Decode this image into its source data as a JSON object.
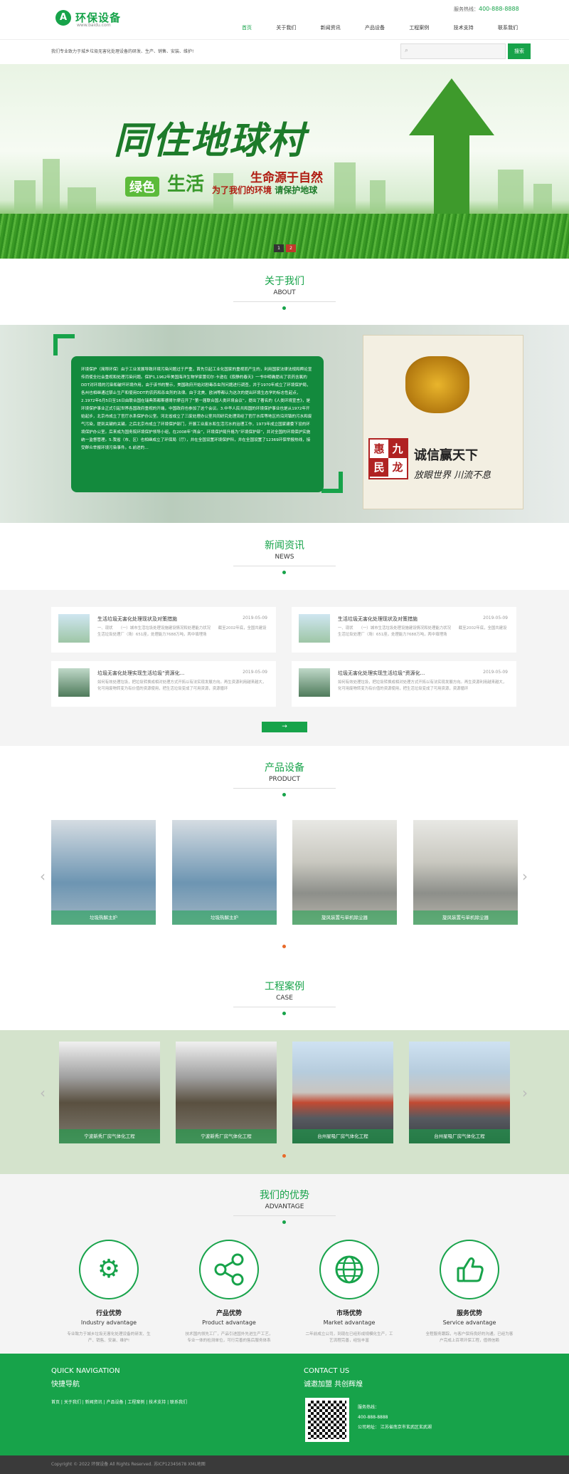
{
  "header": {
    "logo_mark": "A",
    "logo_text": "环保设备",
    "logo_sub": "www.baidu.com",
    "hotline_label": "服务热线：",
    "hotline_number": "400-888-8888",
    "nav": [
      "首页",
      "关于我们",
      "新闻资讯",
      "产品设备",
      "工程案例",
      "技术支持",
      "联系我们"
    ],
    "slogan": "我们专业致力于城乡垃圾无害化处理设备的研发、生产、销售、安装、维护!",
    "search_placeholder": "",
    "search_button": "搜索"
  },
  "banner": {
    "title": "同住地球村",
    "green_tag": "绿色",
    "life": "生活",
    "sub1": "生命源于自然",
    "sub2a": "为了我们的环境",
    "sub2b": "请保护地球",
    "dots": [
      "1",
      "2"
    ]
  },
  "about": {
    "title_cn": "关于我们",
    "title_en": "ABOUT",
    "text": "环境保护（简称环保）由于工业发展导致环境污染问题过于严重，首先引起工业化国家的重视而产生的，利用国家法律法规和舆论宣传而使全社会重视和处理污染问题。保护1,1962年美国海洋生物学家蕾切尔·卡逊在《寂静的春天》一书中明确提出了农药含氯的DDT对环境的污染和破坏环境作用，由于该书的警示，美国政府开始对剧毒杀虫剂问题进行调查，并于1970年成立了环境保护局，各州也相继通过禁止生产和使用DDT的农药和杀虫剂的法律。由于北美、欧洲等都认为这次的提出环境生态学的标志性起点，2.1972年6月5日至16日由联合国在瑞典首都斯德哥尔摩召开了“第一届联合国人类环境会议”，提出了著名的《人类环境宣言》，是环境保护事业正式引起世界各国政府重视的开端，中国政府也参加了这个会议。3.中华人民共和国的环境保护事业也是从1972年开始起步，北京市成立了官厅水系保护办公室。河北省成立了三废处理办公室共同研究处理流经了官厅水库等地区的沿河镇的污水和废气污染，提到关键的关键。之后北京市成立了环境保护部门，开展工业废水和生活污水的治理工作，1973年成立国家建委下设的环境保护办公室。后来成为国务院环境保护领导小组，在2008年“两会”，环境保护局升格为“环境保护部”，并对全国的环境保护实施统一监督管理。5.我省（市、区）也相继成立了环保局（厅），并在全国设置环境保护科，并在全国设置了12369环保举报热线，接受群众举报环境污染事件。6.前进的…",
    "motto": "诚信赢天下",
    "motto2": "放眼世界 川流不息",
    "seal": [
      "惠",
      "九",
      "民",
      "龙"
    ]
  },
  "news": {
    "title_cn": "新闻资讯",
    "title_en": "NEWS",
    "items": [
      {
        "title": "生活垃圾无害化处理现状及对策措施",
        "date": "2019-05-09",
        "desc": "一、现状　　（一）城市生活垃圾处理设施建设情况和处理能力状况　　截至2002年底，全国共建设生活垃圾处理厂（场）651座，处理能力7688万吨，两中填埋场"
      },
      {
        "title": "生活垃圾无害化处理现状及对策措施",
        "date": "2019-05-09",
        "desc": "一、现状　　（一）城市生活垃圾处理设施建设情况和处理能力状况　　截至2002年底，全国共建设生活垃圾处理厂（场）651座，处理能力7688万吨，两中填埋场"
      },
      {
        "title": "垃圾无害化处理实现生活垃圾“资源化...",
        "date": "2019-05-09",
        "desc": "如何有效处理垃圾，把垃圾转换成相对处理方式开拓以有法实现发展方向。再生资源利用越来越大，化可用废物转变为有价值的资源使用，把生活垃圾变成了可用资源，资源循环"
      },
      {
        "title": "垃圾无害化处理实现生活垃圾“资源化...",
        "date": "2019-05-09",
        "desc": "如何有效处理垃圾，把垃圾转换成相对处理方式开拓以有法实现发展方向。再生资源利用越来越大，化可用废物转变为有价值的资源使用，把生活垃圾变成了可用资源，资源循环"
      }
    ],
    "more": "→"
  },
  "products": {
    "title_cn": "产品设备",
    "title_en": "PRODUCT",
    "items": [
      "垃圾热解主炉",
      "垃圾热解主炉",
      "旋风装置与单机除尘器",
      "旋风装置与单机除尘器"
    ]
  },
  "cases": {
    "title_cn": "工程案例",
    "title_en": "CASE",
    "items": [
      "宁波新秀厂房气体化工程",
      "宁波新秀厂房气体化工程",
      "台州星吸厂房气体化工程",
      "台州星吸厂房气体化工程"
    ]
  },
  "advantages": {
    "title_cn": "我们的优势",
    "title_en": "ADVANTAGE",
    "items": [
      {
        "cn": "行业优势",
        "en": "Industry advantage",
        "desc": "专业致力于城乡垃圾无害化处理设备的研发、生产、销售、安装、维护!",
        "icon": "gear-icon"
      },
      {
        "cn": "产品优势",
        "en": "Product advantage",
        "desc": "技术国内领先工厂，产品引进国外先进生产工艺，专业一体的检测单位，可行完善的售后服务体系",
        "icon": "share-icon"
      },
      {
        "cn": "市场优势",
        "en": "Market advantage",
        "desc": "二年前成立公司，到现在已经形成规模化生产，工艺流程完善，经验丰富",
        "icon": "globe-icon"
      },
      {
        "cn": "服务优势",
        "en": "Service advantage",
        "desc": "全程服务跟踪，与客户保持良好的沟通，已经为客户完成上百项环保工程，值得信赖",
        "icon": "thumbs-up-icon"
      }
    ]
  },
  "footer": {
    "qn_en": "QUICK NAVIGATION",
    "qn_cn": "快捷导航",
    "qn_links": "首页 | 关于我们 | 新闻资讯 | 产品设备 | 工程案例 | 技术支持 | 联系我们",
    "ct_en": "CONTACT US",
    "ct_cn": "诚邀加盟 共创辉煌",
    "hotline_label": "服务热线：",
    "hotline": "400-888-8888",
    "address": "公司地址： 江苏省南京市玄武区玄武湖",
    "copyright": "Copyright © 2022 环保设备 All Rights Reserved. 苏ICP12345678 XML地图"
  }
}
